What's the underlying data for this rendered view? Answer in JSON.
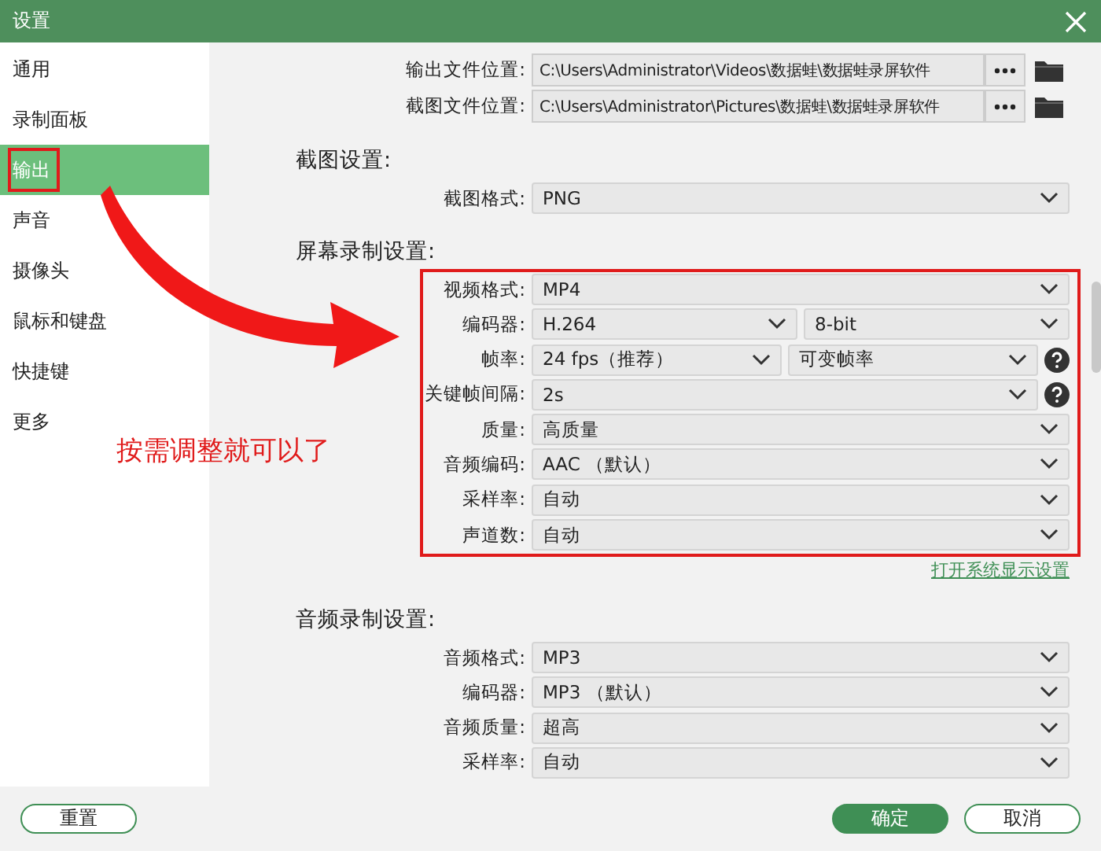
{
  "window": {
    "title": "设置"
  },
  "sidebar": {
    "items": [
      {
        "label": "通用",
        "selected": false
      },
      {
        "label": "录制面板",
        "selected": false
      },
      {
        "label": "输出",
        "selected": true
      },
      {
        "label": "声音",
        "selected": false
      },
      {
        "label": "摄像头",
        "selected": false
      },
      {
        "label": "鼠标和键盘",
        "selected": false
      },
      {
        "label": "快捷键",
        "selected": false
      },
      {
        "label": "更多",
        "selected": false
      }
    ]
  },
  "paths": [
    {
      "label": "输出文件位置:",
      "value": "C:\\Users\\Administrator\\Videos\\数据蛙\\数据蛙录屏软件"
    },
    {
      "label": "截图文件位置:",
      "value": "C:\\Users\\Administrator\\Pictures\\数据蛙\\数据蛙录屏软件"
    }
  ],
  "sections": [
    {
      "heading": "截图设置:",
      "highlighted": false,
      "rows": [
        {
          "label": "截图格式:",
          "help": false,
          "fields": [
            "PNG"
          ]
        }
      ]
    },
    {
      "heading": "屏幕录制设置:",
      "highlighted": true,
      "link": "打开系统显示设置",
      "rows": [
        {
          "label": "视频格式:",
          "help": false,
          "fields": [
            "MP4"
          ]
        },
        {
          "label": "编码器:",
          "help": false,
          "fields": [
            "H.264",
            "8-bit"
          ]
        },
        {
          "label": "帧率:",
          "help": true,
          "fields": [
            "24 fps（推荐）",
            "可变帧率"
          ]
        },
        {
          "label": "关键帧间隔:",
          "help": true,
          "fields": [
            "2s"
          ]
        },
        {
          "label": "质量:",
          "help": false,
          "fields": [
            "高质量"
          ]
        },
        {
          "label": "音频编码:",
          "help": false,
          "fields": [
            "AAC （默认）"
          ]
        },
        {
          "label": "采样率:",
          "help": false,
          "fields": [
            "自动"
          ]
        },
        {
          "label": "声道数:",
          "help": false,
          "fields": [
            "自动"
          ]
        }
      ]
    },
    {
      "heading": "音频录制设置:",
      "highlighted": false,
      "rows": [
        {
          "label": "音频格式:",
          "help": false,
          "fields": [
            "MP3"
          ]
        },
        {
          "label": "编码器:",
          "help": false,
          "fields": [
            "MP3 （默认）"
          ]
        },
        {
          "label": "音频质量:",
          "help": false,
          "fields": [
            "超高"
          ]
        },
        {
          "label": "采样率:",
          "help": false,
          "fields": [
            "自动"
          ]
        }
      ]
    }
  ],
  "annotation": {
    "callout": "按需调整就可以了"
  },
  "buttons": {
    "reset": "重置",
    "ok": "确定",
    "cancel": "取消"
  }
}
